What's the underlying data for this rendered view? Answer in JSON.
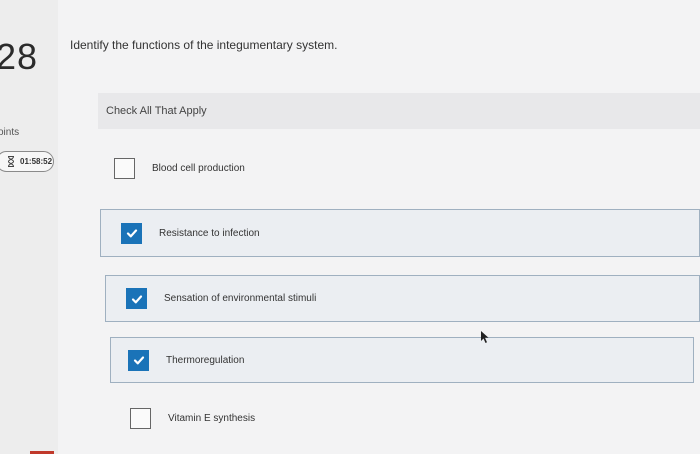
{
  "question": {
    "number": "28",
    "points_label": "oints",
    "timer": "01:58:52",
    "prompt": "Identify the functions of the integumentary system.",
    "instruction": "Check All That Apply"
  },
  "options": [
    {
      "label": "Blood cell production",
      "checked": false
    },
    {
      "label": "Resistance to infection",
      "checked": true
    },
    {
      "label": "Sensation of environmental stimuli",
      "checked": true
    },
    {
      "label": "Thermoregulation",
      "checked": true
    },
    {
      "label": "Vitamin E synthesis",
      "checked": false
    }
  ],
  "colors": {
    "check_fill": "#1a73b8",
    "selected_bg": "#ebeef2",
    "selected_border": "#9fb0c0"
  },
  "icons": {
    "timer": "hourglass-icon",
    "check": "checkmark-icon",
    "cursor": "mouse-pointer-icon"
  }
}
